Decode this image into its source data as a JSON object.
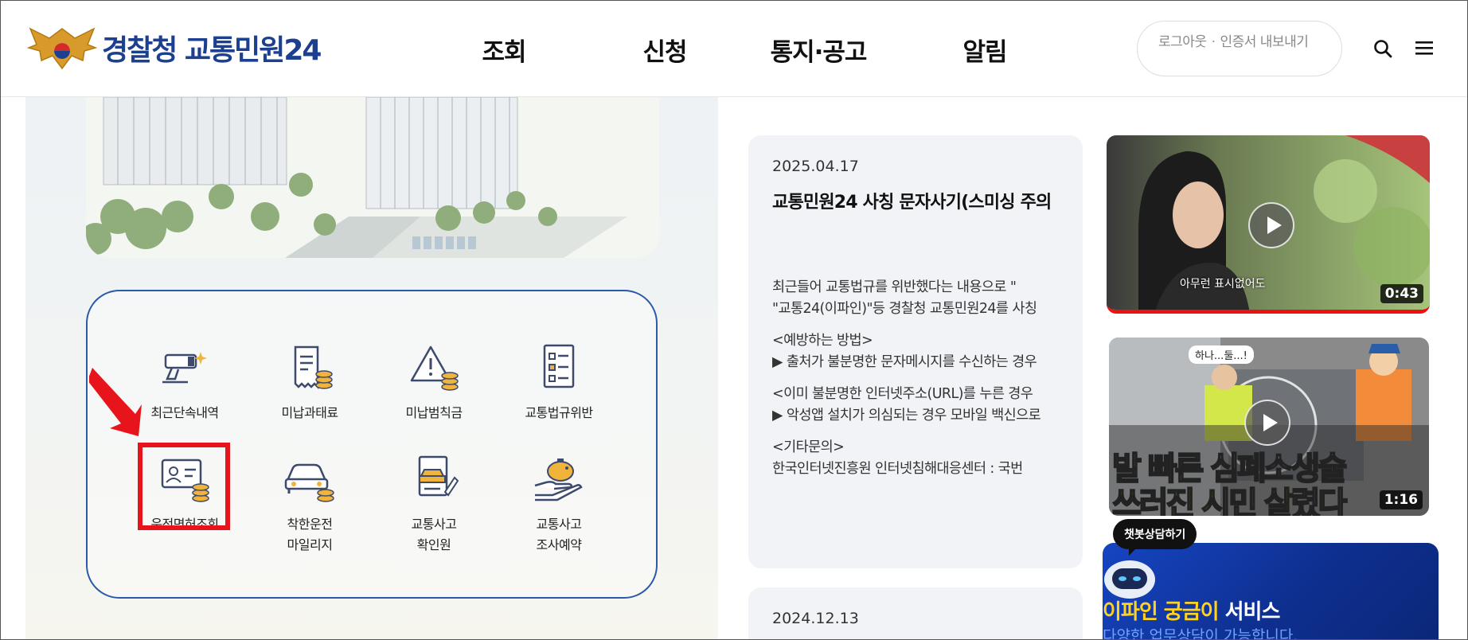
{
  "header": {
    "logo_text": "경찰청 교통민원24",
    "nav": [
      "조회",
      "신청",
      "통지·공고",
      "알림"
    ],
    "util": {
      "logout": "로그아웃",
      "cert_export": "인증서 내보내기"
    }
  },
  "services": [
    {
      "label": "최근단속내역",
      "icon": "camera-icon"
    },
    {
      "label": "미납과태료",
      "icon": "receipt-coins-icon"
    },
    {
      "label": "미납범칙금",
      "icon": "warning-coins-icon"
    },
    {
      "label": "교통법규위반",
      "icon": "checklist-icon"
    },
    {
      "label": "운전면허조회",
      "icon": "license-coins-icon"
    },
    {
      "label_line1": "착한운전",
      "label_line2": "마일리지",
      "icon": "car-coins-icon"
    },
    {
      "label_line1": "교통사고",
      "label_line2": "확인원",
      "icon": "accident-doc-icon"
    },
    {
      "label_line1": "교통사고",
      "label_line2": "조사예약",
      "icon": "hand-piggybank-icon"
    }
  ],
  "notices": [
    {
      "date": "2025.04.17",
      "title": "교통민원24 사칭 문자사기(스미싱 주의",
      "body": [
        "최근들어 교통법규를 위반했다는 내용으로 \"",
        "\"교통24(이파인)\"등 경찰청 교통민원24를 사칭",
        "<예방하는 방법>",
        "▶ 출처가 불분명한 문자메시지를 수신하는 경우",
        "<이미 불분명한 인터넷주소(URL)를 누른 경우",
        "▶ 악성앱 설치가 의심되는 경우 모바일 백신으로",
        "<기타문의>",
        "한국인터넷진흥원 인터넷침해대응센터 : 국번"
      ]
    },
    {
      "date": "2024.12.13"
    }
  ],
  "videos": [
    {
      "duration": "0:43",
      "caption": "아무런 표시없어도"
    },
    {
      "duration": "1:16",
      "bubble": "하나...둘...!",
      "headline1": "발 빠른 심폐소생술",
      "headline2": "쓰러진 시민 살렸다"
    }
  ],
  "chatbot": {
    "tooltip": "챗봇상담하기",
    "title_highlight": "이파인 궁금이",
    "title_rest": " 서비스",
    "subtitle": "다양한 업무상담이 가능합니다."
  },
  "colors": {
    "brand_blue": "#1c3f8f",
    "menu_border": "#2a5aa8",
    "highlight_red": "#e8141b",
    "chat_blue": "#1645c2",
    "chat_yellow": "#ffd21f"
  }
}
